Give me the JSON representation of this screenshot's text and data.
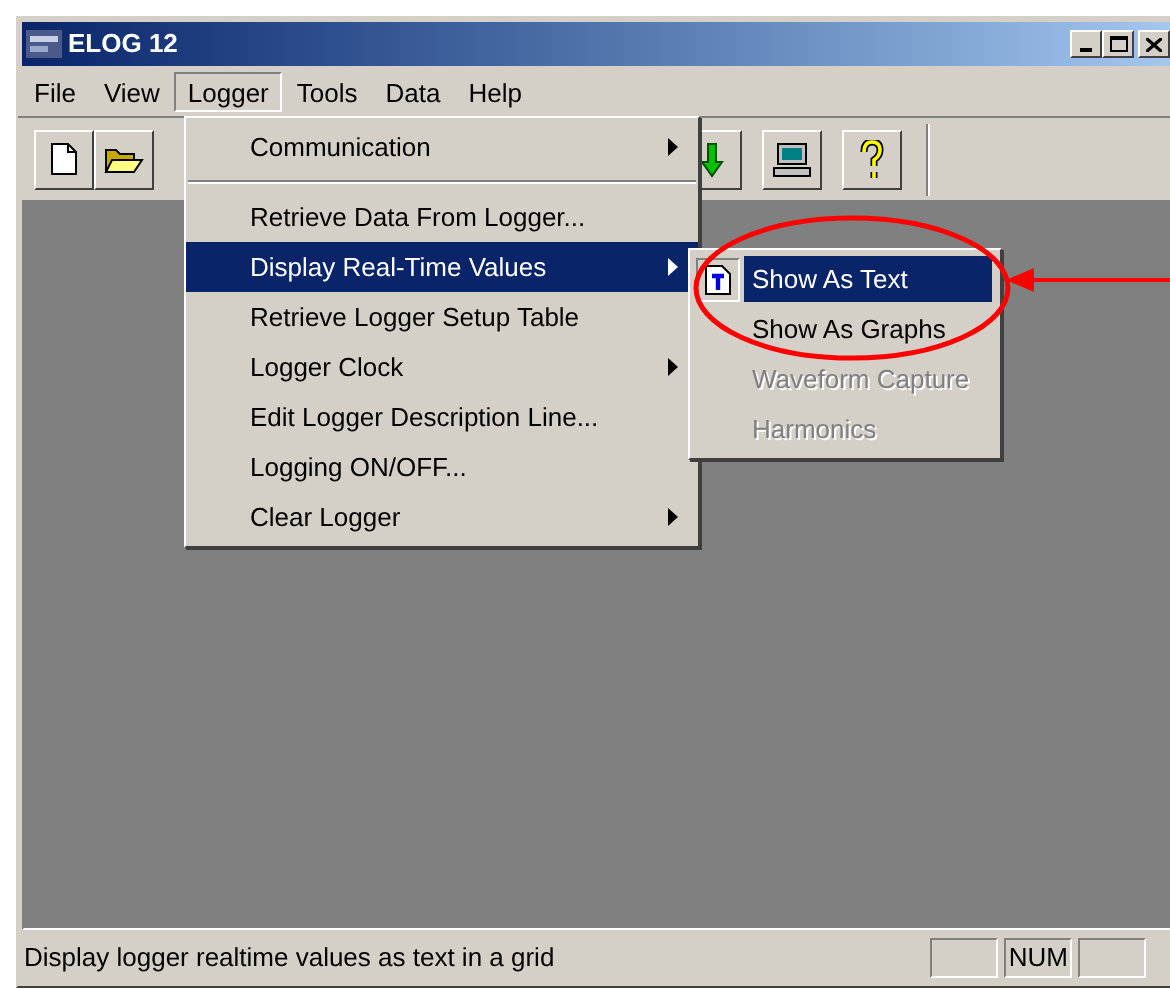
{
  "window": {
    "title": "ELOG 12"
  },
  "menu_bar": [
    {
      "label": "File",
      "selected": false
    },
    {
      "label": "View",
      "selected": false
    },
    {
      "label": "Logger",
      "selected": true
    },
    {
      "label": "Tools",
      "selected": false
    },
    {
      "label": "Data",
      "selected": false
    },
    {
      "label": "Help",
      "selected": false
    }
  ],
  "logger_menu": [
    {
      "kind": "item",
      "label": "Communication",
      "submenu": true,
      "selected": false
    },
    {
      "kind": "separator"
    },
    {
      "kind": "item",
      "label": "Retrieve Data From Logger...",
      "submenu": false,
      "selected": false
    },
    {
      "kind": "item",
      "label": "Display Real-Time Values",
      "submenu": true,
      "selected": true
    },
    {
      "kind": "item",
      "label": "Retrieve Logger Setup Table",
      "submenu": false,
      "selected": false
    },
    {
      "kind": "item",
      "label": "Logger Clock",
      "submenu": true,
      "selected": false
    },
    {
      "kind": "item",
      "label": "Edit Logger Description Line...",
      "submenu": false,
      "selected": false
    },
    {
      "kind": "item",
      "label": "Logging ON/OFF...",
      "submenu": false,
      "selected": false
    },
    {
      "kind": "item",
      "label": "Clear Logger",
      "submenu": true,
      "selected": false
    }
  ],
  "submenu": [
    {
      "label": "Show As Text",
      "icon": true,
      "selected": true,
      "disabled": false
    },
    {
      "label": "Show As Graphs",
      "icon": false,
      "selected": false,
      "disabled": false
    },
    {
      "label": "Waveform Capture",
      "icon": false,
      "selected": false,
      "disabled": true
    },
    {
      "label": "Harmonics",
      "icon": false,
      "selected": false,
      "disabled": true
    }
  ],
  "status_bar": {
    "message": "Display logger realtime values as text in a grid",
    "panes": [
      {
        "kind": "empty"
      },
      {
        "kind": "text",
        "label": "NUM"
      },
      {
        "kind": "empty"
      }
    ]
  }
}
